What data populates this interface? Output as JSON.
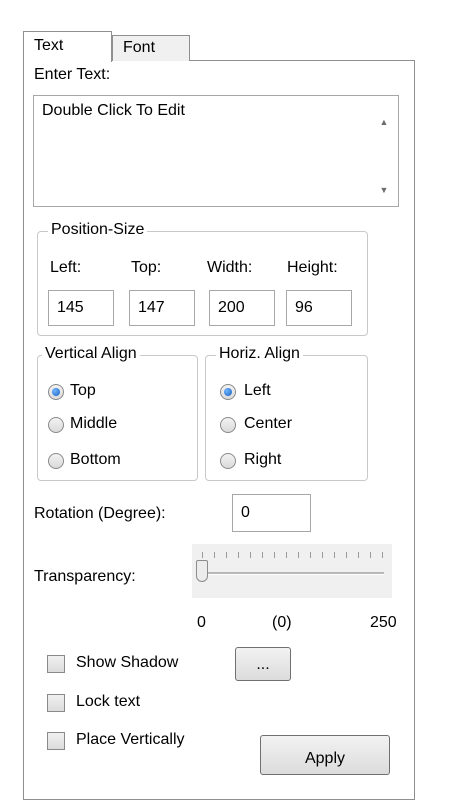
{
  "tabs": {
    "text": "Text",
    "font": "Font"
  },
  "enter_text": {
    "label": "Enter Text:",
    "value": "Double Click To Edit"
  },
  "position_size": {
    "title": "Position-Size",
    "left_label": "Left:",
    "top_label": "Top:",
    "width_label": "Width:",
    "height_label": "Height:",
    "left": "145",
    "top": "147",
    "width": "200",
    "height": "96"
  },
  "vertical_align": {
    "title": "Vertical Align",
    "options": [
      "Top",
      "Middle",
      "Bottom"
    ],
    "selected": "Top"
  },
  "horiz_align": {
    "title": "Horiz. Align",
    "options": [
      "Left",
      "Center",
      "Right"
    ],
    "selected": "Left"
  },
  "rotation": {
    "label": "Rotation (Degree):",
    "value": "0"
  },
  "transparency": {
    "label": "Transparency:",
    "min": "0",
    "current": "(0)",
    "max": "250",
    "level": 0
  },
  "options": {
    "show_shadow": "Show Shadow",
    "shadow_button": "...",
    "lock_text": "Lock text",
    "place_vertically": "Place Vertically"
  },
  "apply_button": "Apply"
}
